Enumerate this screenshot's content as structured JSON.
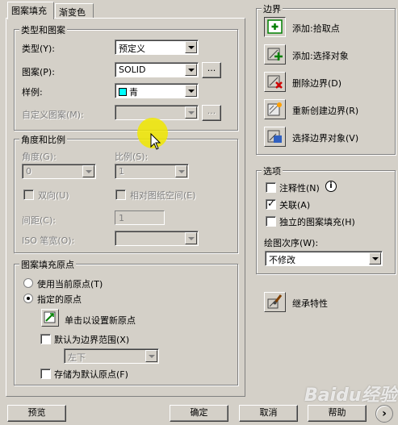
{
  "tabs": [
    {
      "label": "图案填充",
      "active": true
    },
    {
      "label": "渐变色",
      "active": false
    }
  ],
  "type_pattern": {
    "title": "类型和图案",
    "type_label": "类型(Y):",
    "type_value": "预定义",
    "pattern_label": "图案(P):",
    "pattern_value": "SOLID",
    "swatch_label": "样例:",
    "swatch_value": "青",
    "swatch_color": "#00ffff",
    "custom_label": "自定义图案(M):",
    "custom_value": "",
    "browse_label": "..."
  },
  "angle_scale": {
    "title": "角度和比例",
    "angle_label": "角度(G):",
    "angle_value": "0",
    "scale_label": "比例(S):",
    "scale_value": "1",
    "double_label": "双向(U)",
    "relative_label": "相对图纸空间(E)",
    "spacing_label": "间距(C):",
    "spacing_value": "1",
    "iso_label": "ISO 笔宽(O):",
    "iso_value": ""
  },
  "origin": {
    "title": "图案填充原点",
    "use_current_label": "使用当前原点(T)",
    "specified_label": "指定的原点",
    "click_set_label": "单击以设置新原点",
    "default_extent_label": "默认为边界范围(X)",
    "extent_value": "左下",
    "store_default_label": "存储为默认原点(F)"
  },
  "boundaries": {
    "title": "边界",
    "add_pick_label": "添加:拾取点",
    "add_select_label": "添加:选择对象",
    "remove_label": "删除边界(D)",
    "recreate_label": "重新创建边界(R)",
    "view_select_label": "选择边界对象(V)"
  },
  "options": {
    "title": "选项",
    "annotative_label": "注释性(N)",
    "associative_label": "关联(A)",
    "associative_checked": true,
    "separate_label": "独立的图案填充(H)",
    "draw_order_label": "绘图次序(W):",
    "draw_order_value": "不修改"
  },
  "inherit_label": "继承特性",
  "footer": {
    "preview_label": "预览",
    "ok_label": "确定",
    "cancel_label": "取消",
    "help_label": "帮助"
  },
  "watermark": "Baidu经验",
  "colors": {
    "dialog_bg": "#d4d0c8",
    "cursor_highlight": "#f0e800"
  }
}
